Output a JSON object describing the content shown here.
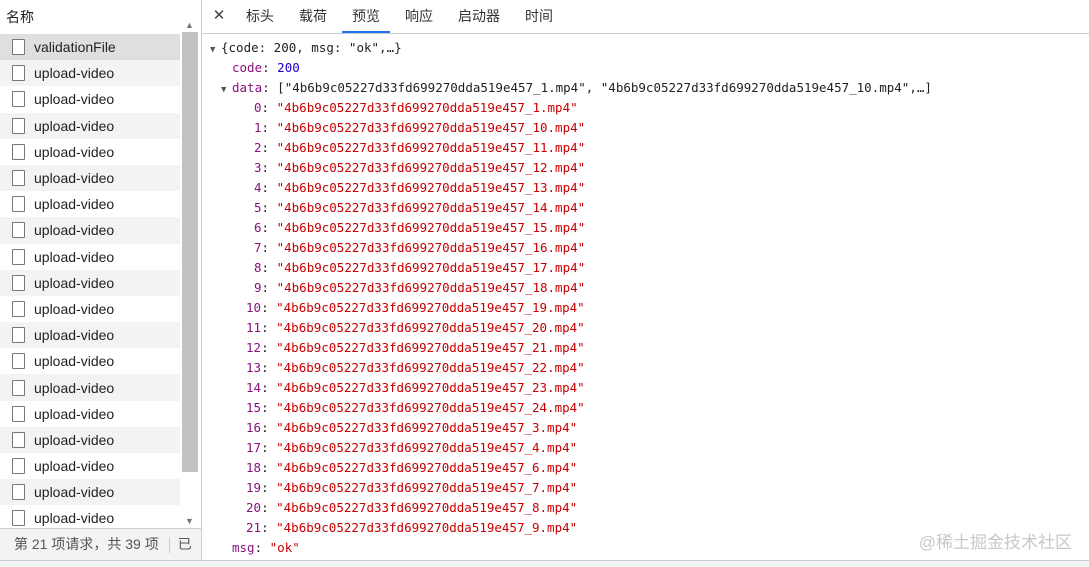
{
  "left": {
    "header": "名称",
    "items": [
      "validationFile",
      "upload-video",
      "upload-video",
      "upload-video",
      "upload-video",
      "upload-video",
      "upload-video",
      "upload-video",
      "upload-video",
      "upload-video",
      "upload-video",
      "upload-video",
      "upload-video",
      "upload-video",
      "upload-video",
      "upload-video",
      "upload-video",
      "upload-video",
      "upload-video"
    ],
    "status": "第 21 项请求，共 39 项",
    "status_trunc": "已"
  },
  "tabs": [
    "标头",
    "载荷",
    "预览",
    "响应",
    "启动器",
    "时间"
  ],
  "active_tab": "预览",
  "json": {
    "summary": "{code: 200, msg: \"ok\",…}",
    "code_key": "code",
    "code_val": "200",
    "data_key": "data",
    "data_summary": "[\"4b6b9c05227d33fd699270dda519e457_1.mp4\", \"4b6b9c05227d33fd699270dda519e457_10.mp4\",…]",
    "data": [
      "4b6b9c05227d33fd699270dda519e457_1.mp4",
      "4b6b9c05227d33fd699270dda519e457_10.mp4",
      "4b6b9c05227d33fd699270dda519e457_11.mp4",
      "4b6b9c05227d33fd699270dda519e457_12.mp4",
      "4b6b9c05227d33fd699270dda519e457_13.mp4",
      "4b6b9c05227d33fd699270dda519e457_14.mp4",
      "4b6b9c05227d33fd699270dda519e457_15.mp4",
      "4b6b9c05227d33fd699270dda519e457_16.mp4",
      "4b6b9c05227d33fd699270dda519e457_17.mp4",
      "4b6b9c05227d33fd699270dda519e457_18.mp4",
      "4b6b9c05227d33fd699270dda519e457_19.mp4",
      "4b6b9c05227d33fd699270dda519e457_20.mp4",
      "4b6b9c05227d33fd699270dda519e457_21.mp4",
      "4b6b9c05227d33fd699270dda519e457_22.mp4",
      "4b6b9c05227d33fd699270dda519e457_23.mp4",
      "4b6b9c05227d33fd699270dda519e457_24.mp4",
      "4b6b9c05227d33fd699270dda519e457_3.mp4",
      "4b6b9c05227d33fd699270dda519e457_4.mp4",
      "4b6b9c05227d33fd699270dda519e457_6.mp4",
      "4b6b9c05227d33fd699270dda519e457_7.mp4",
      "4b6b9c05227d33fd699270dda519e457_8.mp4",
      "4b6b9c05227d33fd699270dda519e457_9.mp4"
    ],
    "msg_key": "msg",
    "msg_val": "\"ok\""
  },
  "watermark": "@稀土掘金技术社区"
}
